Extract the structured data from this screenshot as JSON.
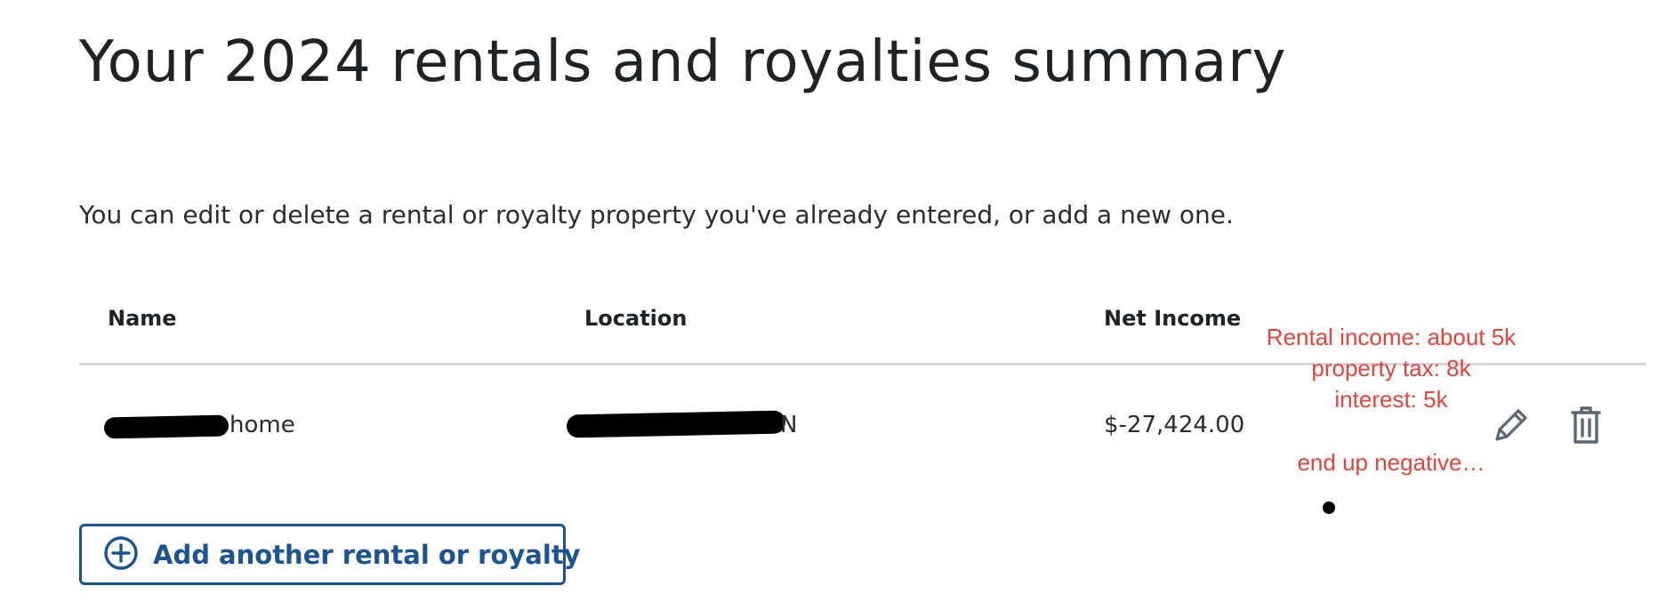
{
  "page": {
    "title": "Your 2024 rentals and royalties summary",
    "intro": "You can edit or delete a rental or royalty property you've already entered, or add a new one."
  },
  "table": {
    "columns": [
      "Name",
      "Location",
      "Net Income"
    ],
    "rows": [
      {
        "name_visible": "home",
        "location_visible": "N",
        "net_income": "$-27,424.00",
        "actions": [
          "pencil-icon",
          "trash-icon"
        ]
      }
    ]
  },
  "add_button": {
    "label": "Add another rental or royalty",
    "icon": "plus-circle-icon"
  },
  "annotation": {
    "lines": [
      "Rental income:  about 5k",
      "property tax: 8k",
      "interest: 5k",
      "end up negative…"
    ]
  },
  "colors": {
    "accent": "#1b5494",
    "annotation": "#e5433b",
    "rule": "#d4d8dc",
    "icon": "#5d6773"
  }
}
